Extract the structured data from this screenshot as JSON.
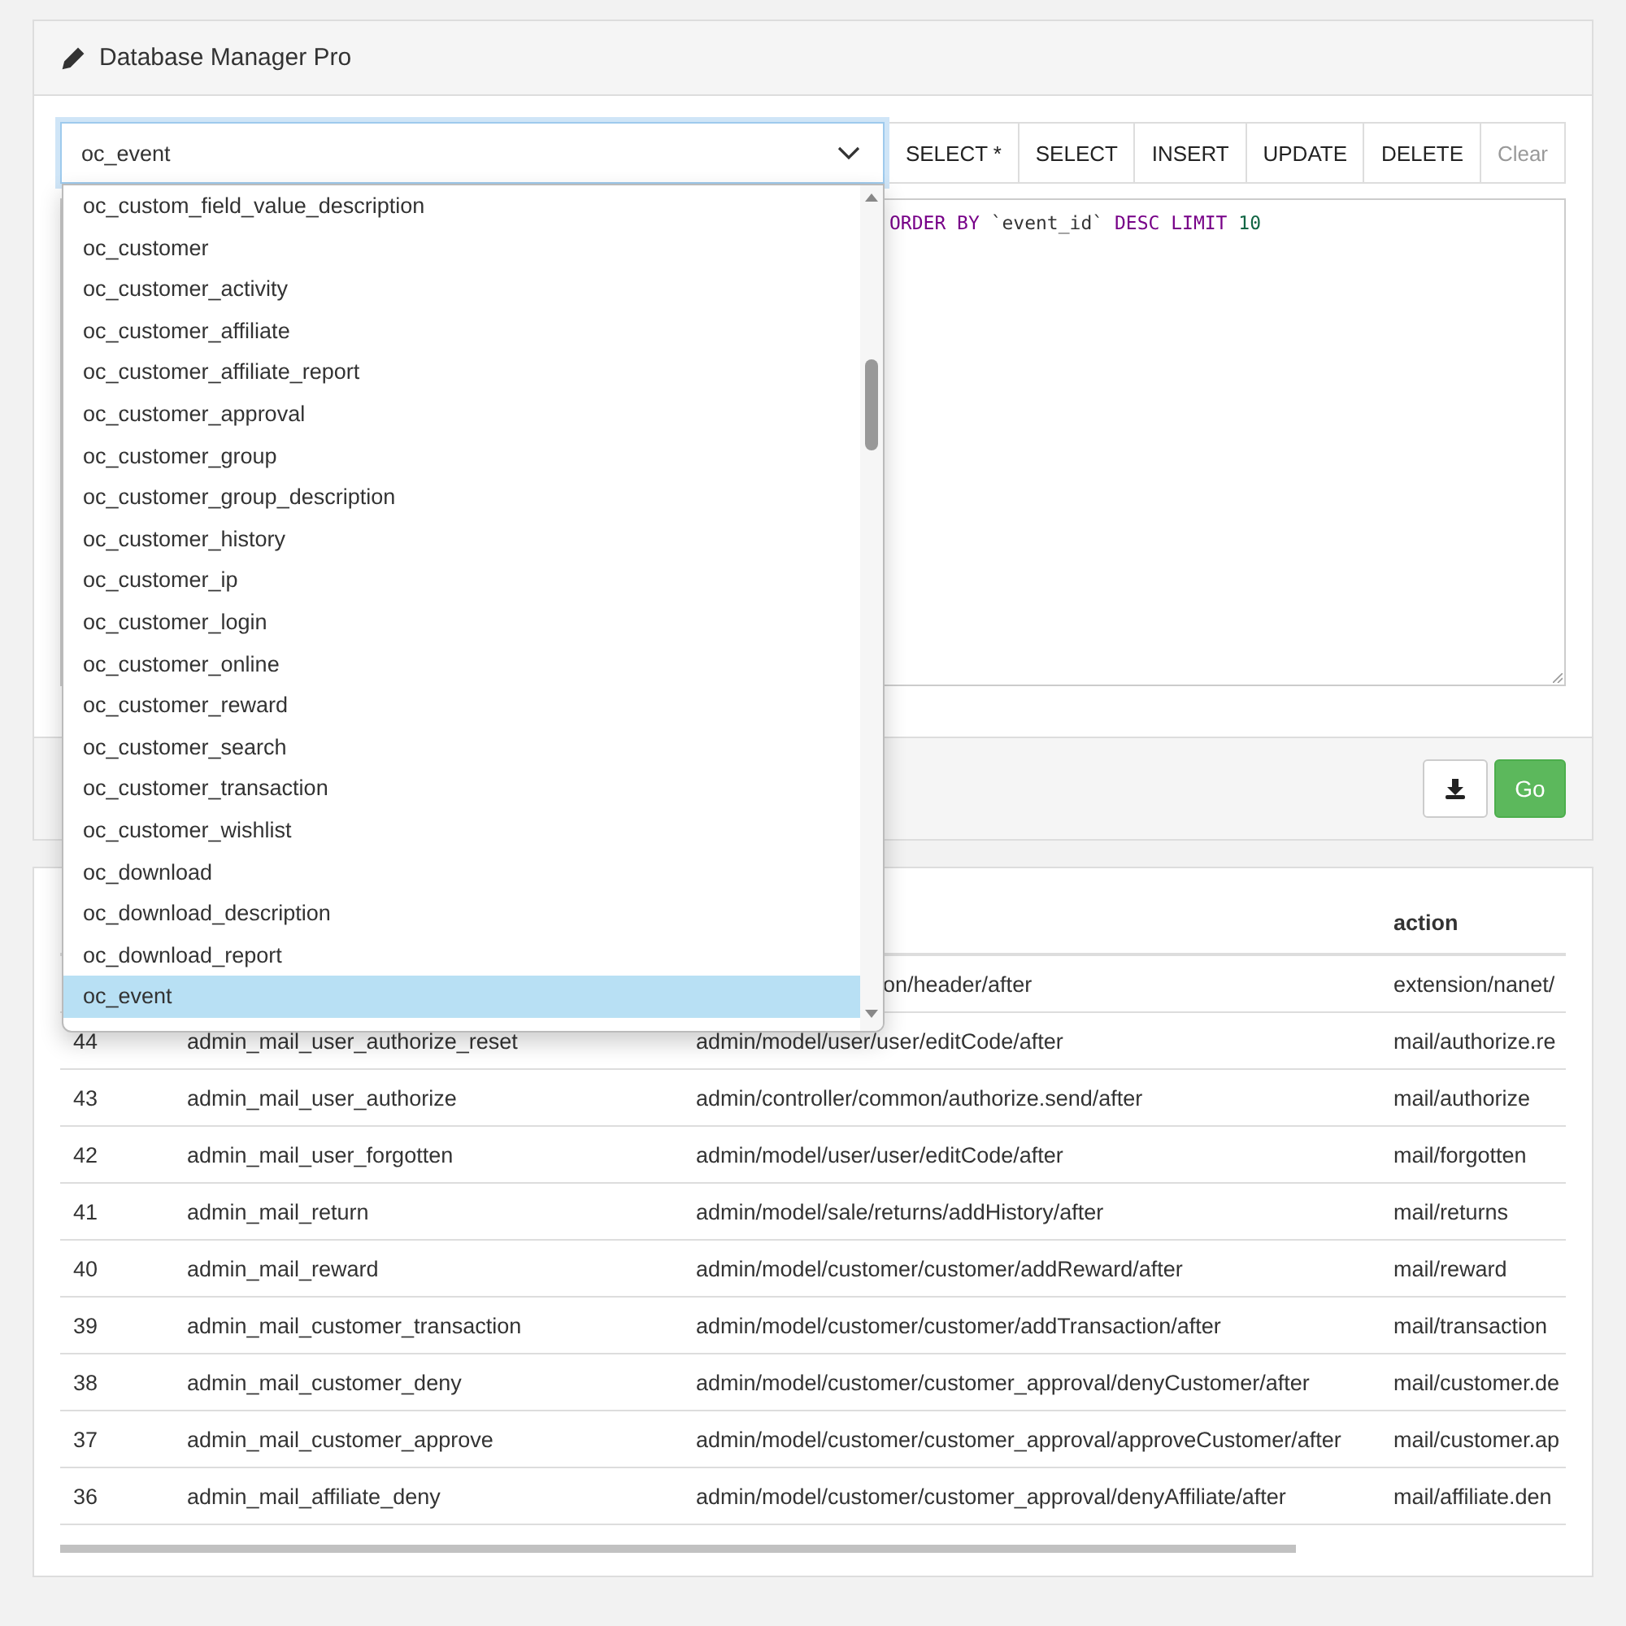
{
  "panel": {
    "title": "Database Manager Pro"
  },
  "table_select": {
    "value": "oc_event",
    "options": [
      {
        "label": "oc_custom_field_value_description",
        "selected": false
      },
      {
        "label": "oc_customer",
        "selected": false
      },
      {
        "label": "oc_customer_activity",
        "selected": false
      },
      {
        "label": "oc_customer_affiliate",
        "selected": false
      },
      {
        "label": "oc_customer_affiliate_report",
        "selected": false
      },
      {
        "label": "oc_customer_approval",
        "selected": false
      },
      {
        "label": "oc_customer_group",
        "selected": false
      },
      {
        "label": "oc_customer_group_description",
        "selected": false
      },
      {
        "label": "oc_customer_history",
        "selected": false
      },
      {
        "label": "oc_customer_ip",
        "selected": false
      },
      {
        "label": "oc_customer_login",
        "selected": false
      },
      {
        "label": "oc_customer_online",
        "selected": false
      },
      {
        "label": "oc_customer_reward",
        "selected": false
      },
      {
        "label": "oc_customer_search",
        "selected": false
      },
      {
        "label": "oc_customer_transaction",
        "selected": false
      },
      {
        "label": "oc_customer_wishlist",
        "selected": false
      },
      {
        "label": "oc_download",
        "selected": false
      },
      {
        "label": "oc_download_description",
        "selected": false
      },
      {
        "label": "oc_download_report",
        "selected": false
      },
      {
        "label": "oc_event",
        "selected": true
      }
    ]
  },
  "query_buttons": [
    {
      "label": "SELECT *",
      "disabled": false
    },
    {
      "label": "SELECT",
      "disabled": false
    },
    {
      "label": "INSERT",
      "disabled": false
    },
    {
      "label": "UPDATE",
      "disabled": false
    },
    {
      "label": "DELETE",
      "disabled": false
    },
    {
      "label": "Clear",
      "disabled": true
    }
  ],
  "editor": {
    "tokens": [
      {
        "text": "ORDER BY",
        "kind": "keyword"
      },
      {
        "text": "`event_id`",
        "kind": "name"
      },
      {
        "text": "DESC LIMIT",
        "kind": "keyword"
      },
      {
        "text": "10",
        "kind": "number"
      }
    ]
  },
  "run_button": {
    "label": "Go"
  },
  "table": {
    "column_4_heading": "action",
    "rows": [
      {
        "column_3": "on/header/after",
        "column_4": "extension/nanet/"
      },
      {
        "column_1": "44",
        "column_2": "admin_mail_user_authorize_reset",
        "column_3": "admin/model/user/user/editCode/after",
        "column_4": "mail/authorize.re"
      },
      {
        "column_1": "43",
        "column_2": "admin_mail_user_authorize",
        "column_3": "admin/controller/common/authorize.send/after",
        "column_4": "mail/authorize"
      },
      {
        "column_1": "42",
        "column_2": "admin_mail_user_forgotten",
        "column_3": "admin/model/user/user/editCode/after",
        "column_4": "mail/forgotten"
      },
      {
        "column_1": "41",
        "column_2": "admin_mail_return",
        "column_3": "admin/model/sale/returns/addHistory/after",
        "column_4": "mail/returns"
      },
      {
        "column_1": "40",
        "column_2": "admin_mail_reward",
        "column_3": "admin/model/customer/customer/addReward/after",
        "column_4": "mail/reward"
      },
      {
        "column_1": "39",
        "column_2": "admin_mail_customer_transaction",
        "column_3": "admin/model/customer/customer/addTransaction/after",
        "column_4": "mail/transaction"
      },
      {
        "column_1": "38",
        "column_2": "admin_mail_customer_deny",
        "column_3": "admin/model/customer/customer_approval/denyCustomer/after",
        "column_4": "mail/customer.de"
      },
      {
        "column_1": "37",
        "column_2": "admin_mail_customer_approve",
        "column_3": "admin/model/customer/customer_approval/approveCustomer/after",
        "column_4": "mail/customer.ap"
      },
      {
        "column_1": "36",
        "column_2": "admin_mail_affiliate_deny",
        "column_3": "admin/model/customer/customer_approval/denyAffiliate/after",
        "column_4": "mail/affiliate.den"
      }
    ]
  }
}
